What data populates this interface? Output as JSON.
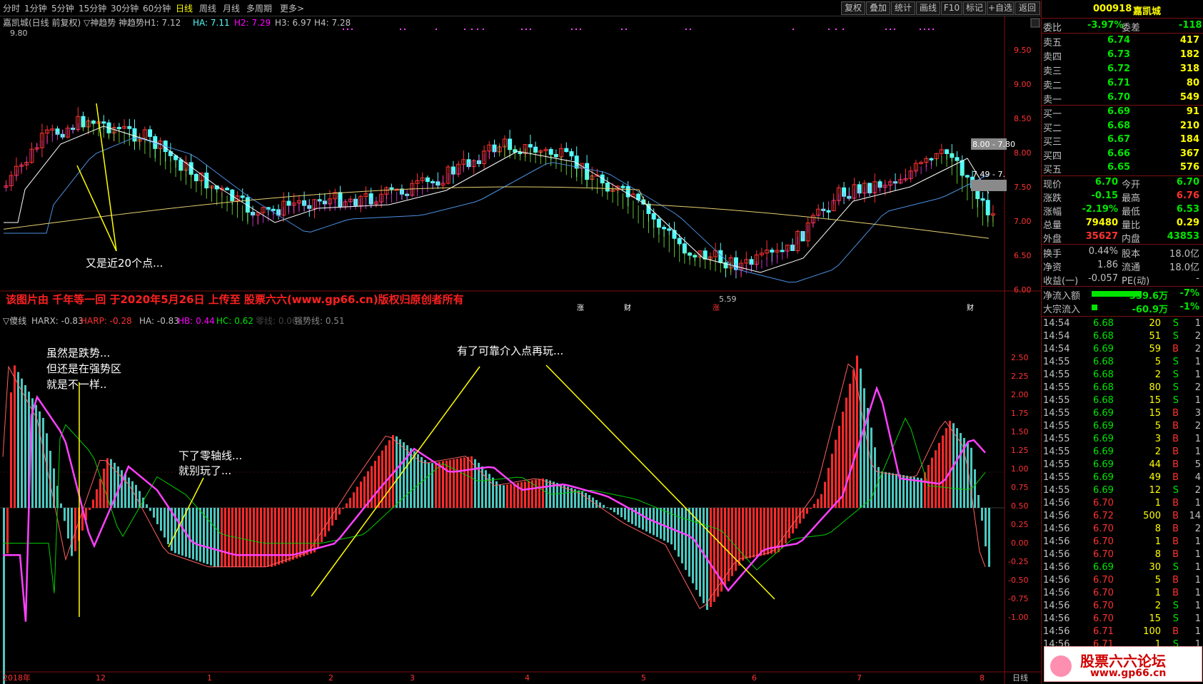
{
  "toolbar": {
    "timeframes": [
      "分时",
      "1分钟",
      "5分钟",
      "15分钟",
      "30分钟",
      "60分钟",
      "日线",
      "周线",
      "月线",
      "多周期",
      "更多>"
    ],
    "active_index": 6,
    "buttons": [
      "复权",
      "叠加",
      "统计",
      "画线",
      "F10",
      "标记",
      "+自选",
      "返回"
    ]
  },
  "main_chart": {
    "title": "嘉凯城(日线 前复权) ▽神趋势",
    "indicator_label": "神趋势H1: 7.12",
    "ha_label": "HA: 7.11",
    "h2_label": "H2: 7.29",
    "h3_label": "H3: 6.97",
    "h4_label": "H4: 7.28",
    "y_ticks": [
      "9.50",
      "9.00",
      "8.50",
      "8.00",
      "7.50",
      "7.00",
      "6.50",
      "6.00"
    ],
    "high_mark": "9.80",
    "low_mark": "5.59",
    "level1": "8.00 - 7.80",
    "level2": "7.49 - 7.",
    "annotation": "又是近20个点...",
    "watermark": "该图片由 千年等一回 于2020年5月26日 上传至 股票六六(www.gp66.cn)版权归原创者所有",
    "markers": [
      "涨",
      "财",
      "涨",
      "财"
    ]
  },
  "sub_chart": {
    "title": "▽傻线",
    "harx": "HARX: -0.83",
    "harp": "HARP: -0.28",
    "ha": "HA: -0.83",
    "hb": "HB: 0.44",
    "hc": "HC: 0.62",
    "zero": "零线: 0.00",
    "strong": "强势线: 0.51",
    "y_ticks": [
      "2.50",
      "2.25",
      "2.00",
      "1.75",
      "1.50",
      "1.25",
      "1.00",
      "0.75",
      "0.50",
      "0.25",
      "0.00",
      "-0.25",
      "-0.50",
      "-0.75",
      "-1.00"
    ],
    "annotation1": [
      "虽然是跌势...",
      "但还是在强势区",
      "就是不一样.."
    ],
    "annotation2": [
      "下了零轴线...",
      "就别玩了..."
    ],
    "annotation3": "有了可靠介入点再玩..."
  },
  "x_axis": {
    "labels": [
      "2018年",
      "12",
      "1",
      "2",
      "3",
      "4",
      "5",
      "6",
      "7",
      "8"
    ],
    "mode": "日线"
  },
  "right_panel": {
    "code": "000918",
    "name": "嘉凯城",
    "weibi": {
      "label": "委比",
      "value": "-3.97%",
      "label2": "委差",
      "value2": "-118"
    },
    "asks": [
      {
        "label": "卖五",
        "price": "6.74",
        "vol": "417"
      },
      {
        "label": "卖四",
        "price": "6.73",
        "vol": "182"
      },
      {
        "label": "卖三",
        "price": "6.72",
        "vol": "318"
      },
      {
        "label": "卖二",
        "price": "6.71",
        "vol": "80"
      },
      {
        "label": "卖一",
        "price": "6.70",
        "vol": "549"
      }
    ],
    "bids": [
      {
        "label": "买一",
        "price": "6.69",
        "vol": "91"
      },
      {
        "label": "买二",
        "price": "6.68",
        "vol": "210"
      },
      {
        "label": "买三",
        "price": "6.67",
        "vol": "184"
      },
      {
        "label": "买四",
        "price": "6.66",
        "vol": "367"
      },
      {
        "label": "买五",
        "price": "6.65",
        "vol": "576"
      }
    ],
    "quote": [
      {
        "l1": "现价",
        "v1": "6.70",
        "l2": "今开",
        "v2": "6.70"
      },
      {
        "l1": "涨跌",
        "v1": "-0.15",
        "l2": "最高",
        "v2": "6.76"
      },
      {
        "l1": "涨幅",
        "v1": "-2.19%",
        "l2": "最低",
        "v2": "6.53"
      },
      {
        "l1": "总量",
        "v1": "79480",
        "l2": "量比",
        "v2": "0.29"
      },
      {
        "l1": "外盘",
        "v1": "35627",
        "l2": "内盘",
        "v2": "43853"
      }
    ],
    "stats": [
      {
        "l1": "换手",
        "v1": "0.44%",
        "l2": "股本",
        "v2": "18.0亿"
      },
      {
        "l1": "净资",
        "v1": "1.86",
        "l2": "流通",
        "v2": "18.0亿"
      },
      {
        "l1": "收益(一)",
        "v1": "-0.057",
        "l2": "PE(动)",
        "v2": "-"
      }
    ],
    "flow": [
      {
        "label": "净流入额",
        "value": "-359.6万",
        "pct": "-7%"
      },
      {
        "label": "大宗流入",
        "value": "-60.9万",
        "pct": "-1%"
      }
    ],
    "ticks": [
      [
        "14:54",
        "6.68",
        "20",
        "S",
        "1"
      ],
      [
        "14:54",
        "6.68",
        "51",
        "S",
        "2"
      ],
      [
        "14:54",
        "6.69",
        "59",
        "B",
        "2"
      ],
      [
        "14:55",
        "6.68",
        "5",
        "S",
        "1"
      ],
      [
        "14:55",
        "6.68",
        "2",
        "S",
        "1"
      ],
      [
        "14:55",
        "6.68",
        "80",
        "S",
        "2"
      ],
      [
        "14:55",
        "6.68",
        "15",
        "S",
        "1"
      ],
      [
        "14:55",
        "6.69",
        "15",
        "B",
        "3"
      ],
      [
        "14:55",
        "6.69",
        "5",
        "B",
        "2"
      ],
      [
        "14:55",
        "6.69",
        "3",
        "B",
        "1"
      ],
      [
        "14:55",
        "6.69",
        "2",
        "B",
        "1"
      ],
      [
        "14:55",
        "6.69",
        "44",
        "B",
        "5"
      ],
      [
        "14:55",
        "6.69",
        "49",
        "B",
        "4"
      ],
      [
        "14:55",
        "6.69",
        "12",
        "S",
        "2"
      ],
      [
        "14:56",
        "6.70",
        "1",
        "B",
        "1"
      ],
      [
        "14:56",
        "6.72",
        "500",
        "B",
        "14"
      ],
      [
        "14:56",
        "6.70",
        "8",
        "B",
        "2"
      ],
      [
        "14:56",
        "6.70",
        "1",
        "B",
        "1"
      ],
      [
        "14:56",
        "6.70",
        "8",
        "B",
        "1"
      ],
      [
        "14:56",
        "6.69",
        "30",
        "S",
        "1"
      ],
      [
        "14:56",
        "6.70",
        "5",
        "B",
        "1"
      ],
      [
        "14:56",
        "6.70",
        "1",
        "B",
        "1"
      ],
      [
        "14:56",
        "6.70",
        "2",
        "S",
        "1"
      ],
      [
        "14:56",
        "6.70",
        "15",
        "S",
        "1"
      ],
      [
        "14:56",
        "6.71",
        "100",
        "B",
        "1"
      ],
      [
        "14:56",
        "6.71",
        "1",
        "S",
        "1"
      ]
    ],
    "logo_line1": "股票六六论坛",
    "logo_line2": "www.gp66.cn"
  },
  "colors": {
    "up": "#ff3232",
    "down": "#54fcfc",
    "green_price": "#00e600",
    "yellow": "#ffff00",
    "magenta": "#ff00ff",
    "grid_red": "#7a1010"
  }
}
